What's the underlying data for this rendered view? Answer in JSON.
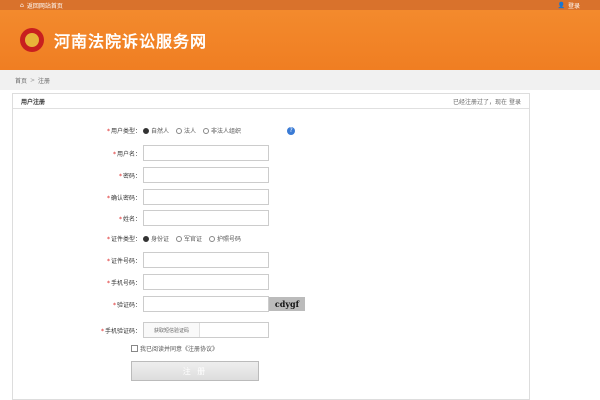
{
  "topbar": {
    "home_link": "返回网站首页",
    "login": "登录"
  },
  "banner": {
    "title": "河南法院诉讼服务网"
  },
  "breadcrumb": {
    "home": "首页",
    "current": "注册"
  },
  "panel": {
    "title": "用户注册",
    "have_account": "已经注册过了，现在",
    "login_link": "登录"
  },
  "form": {
    "user_type": {
      "label": "用户类型：",
      "options": [
        "自然人",
        "法人",
        "非法人组织"
      ]
    },
    "username": {
      "label": "用户名：",
      "value": ""
    },
    "password": {
      "label": "密码：",
      "value": ""
    },
    "confirm_password": {
      "label": "确认密码：",
      "value": ""
    },
    "name": {
      "label": "姓名：",
      "value": ""
    },
    "id_type": {
      "label": "证件类型：",
      "options": [
        "身份证",
        "军官证",
        "护照号码"
      ]
    },
    "id_number": {
      "label": "证件号码：",
      "value": ""
    },
    "phone": {
      "label": "手机号码：",
      "value": ""
    },
    "captcha": {
      "label": "验证码：",
      "value": "",
      "image_text": "cdygf"
    },
    "sms_code": {
      "label": "手机验证码：",
      "button": "获取短信验证码",
      "value": ""
    },
    "agreement": {
      "text": "我已阅读并同意《注册协议》"
    },
    "submit": {
      "label": "注 册"
    }
  },
  "colors": {
    "accent": "#f07e22",
    "topbar": "#d9722c"
  }
}
